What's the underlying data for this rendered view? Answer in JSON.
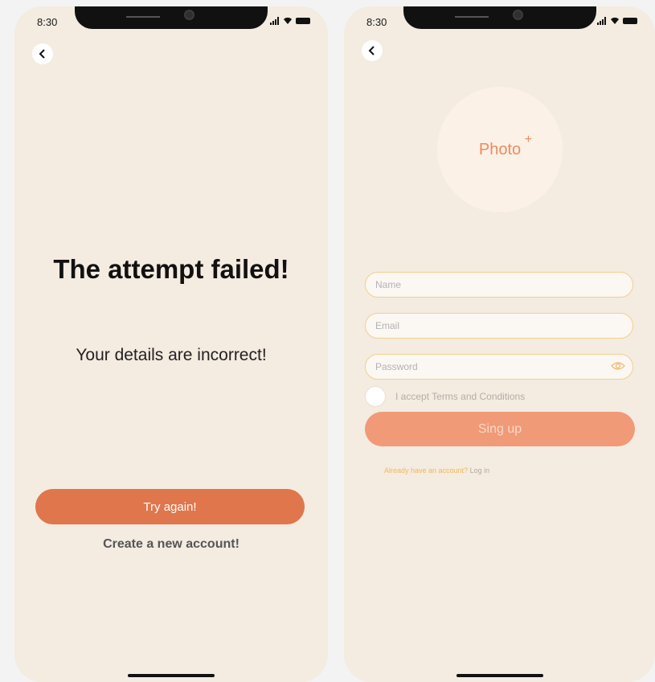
{
  "status_bar": {
    "time": "8:30"
  },
  "fail_screen": {
    "title": "The attempt failed!",
    "message": "Your details are incorrect!",
    "try_again_label": "Try again!",
    "create_account_label": "Create a new account!"
  },
  "signup_screen": {
    "photo_label": "Photo",
    "photo_plus": "+",
    "name_placeholder": "Name",
    "email_placeholder": "Email",
    "password_placeholder": "Password",
    "terms_label": "I accept Terms and Conditions",
    "signup_label": "Sing up",
    "already_account": "Already have an account?",
    "login_label": "Log in"
  },
  "colors": {
    "background": "#f4ebe1",
    "primary": "#e0764c",
    "primary_light": "#f09a78",
    "field_border": "#f3d08e"
  },
  "icons": {
    "back": "chevron-left-icon",
    "eye": "eye-icon"
  }
}
